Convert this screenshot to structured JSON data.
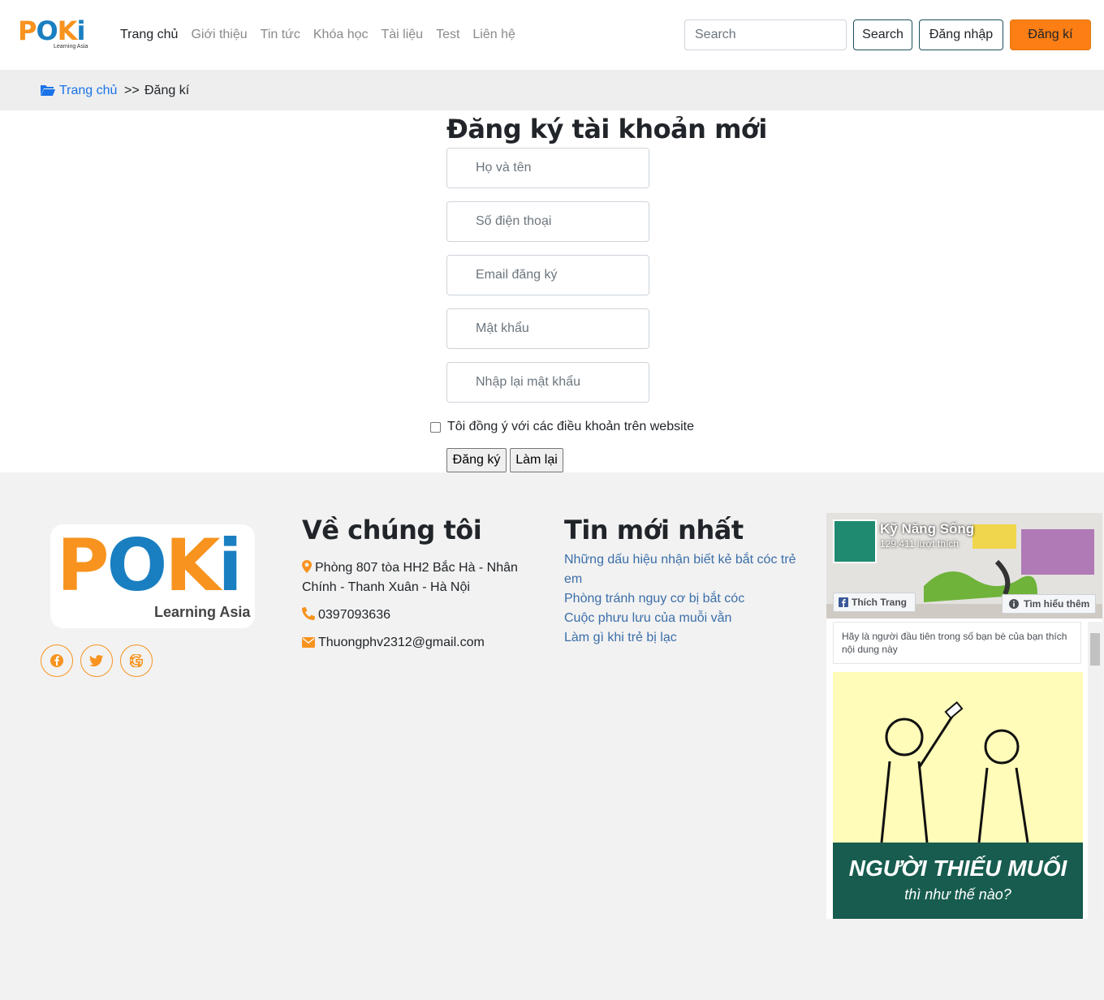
{
  "brand": {
    "logo_text": "POKi",
    "logo_sub": "Learning Asia"
  },
  "nav": {
    "items": [
      "Trang chủ",
      "Giới thiệu",
      "Tin tức",
      "Khóa học",
      "Tài liệu",
      "Test",
      "Liên hệ"
    ]
  },
  "header": {
    "search_placeholder": "Search",
    "search_button": "Search",
    "login_button": "Đăng nhập",
    "register_button": "Đăng kí",
    "colors": {
      "accent": "#fd7e14",
      "outline": "#1b4f5a"
    }
  },
  "breadcrumb": {
    "home": "Trang chủ",
    "separator": ">>",
    "current": "Đăng kí"
  },
  "form": {
    "title": "Đăng ký tài khoản mới",
    "fields": {
      "name": "Họ và tên",
      "phone": "Số điện thoại",
      "email": "Email đăng ký",
      "password": "Mật khẩu",
      "confirm": "Nhập lại mật khẩu"
    },
    "terms_label": "Tôi đồng ý với các điều khoản trên website",
    "submit": "Đăng ký",
    "reset": "Làm lại"
  },
  "footer": {
    "about_title": "Về chúng tôi",
    "address": "Phòng 807 tòa HH2 Bắc Hà - Nhân Chính - Thanh Xuân - Hà Nội",
    "phone": "0397093636",
    "email": "Thuongphv2312@gmail.com",
    "news_title": "Tin mới nhất",
    "news": [
      "Những dấu hiệu nhận biết kẻ bắt cóc trẻ em",
      "Phòng tránh nguy cơ bị bắt cóc",
      "Cuộc phưu lưu của muỗi vằn",
      "Làm gì khi trẻ bị lạc"
    ],
    "socials": [
      "facebook-icon",
      "twitter-icon",
      "google-icon"
    ]
  },
  "facebook": {
    "page_name": "Kỹ Năng Sống",
    "likes": "129.411 lượt thích",
    "like_button": "Thích Trang",
    "more_button": "Tìm hiểu thêm",
    "friends_text": "Hãy là người đầu tiên trong số bạn bè của bạn thích nội dung này",
    "post_title": "NGƯỜI THIẾU MUỐI",
    "post_subtitle": "thì như thế nào?"
  }
}
